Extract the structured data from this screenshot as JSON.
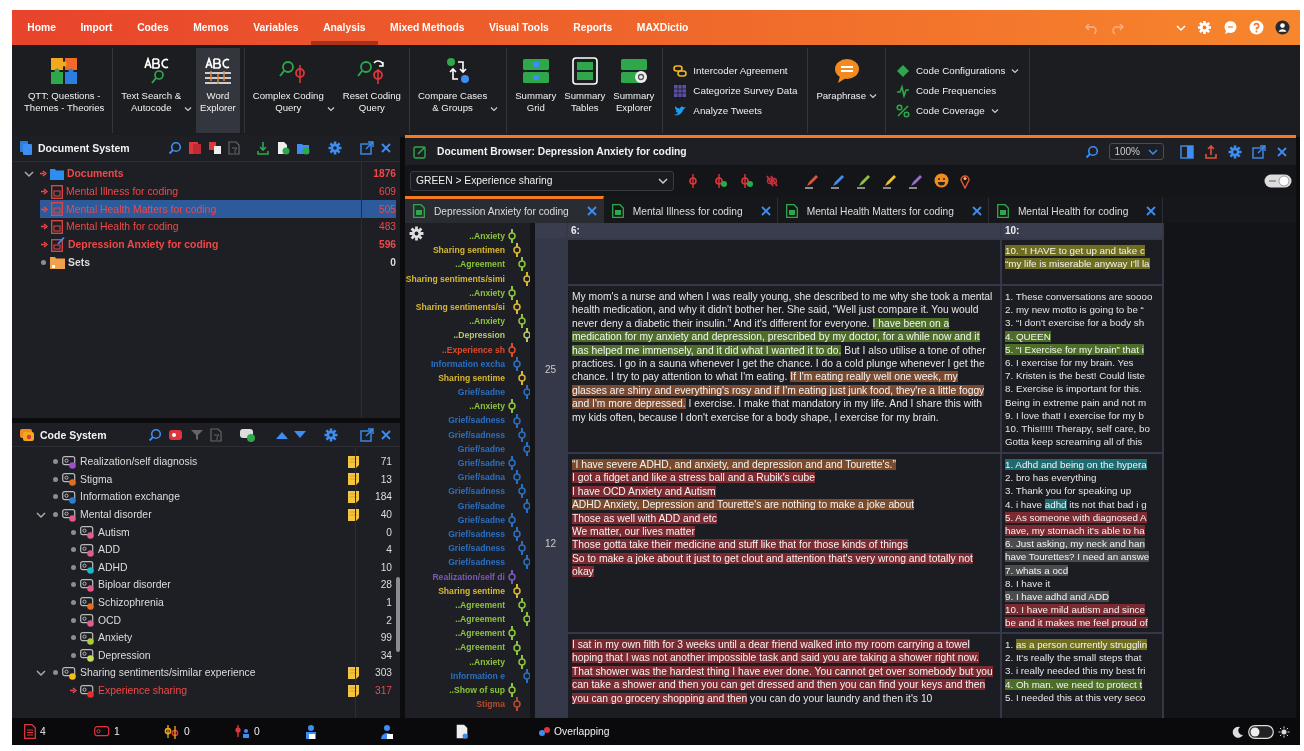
{
  "menu_tabs": [
    {
      "label": "Home",
      "selected": false
    },
    {
      "label": "Import",
      "selected": false
    },
    {
      "label": "Codes",
      "selected": false
    },
    {
      "label": "Memos",
      "selected": false
    },
    {
      "label": "Variables",
      "selected": false
    },
    {
      "label": "Analysis",
      "selected": true
    },
    {
      "label": "Mixed Methods",
      "selected": false
    },
    {
      "label": "Visual Tools",
      "selected": false
    },
    {
      "label": "Reports",
      "selected": false
    },
    {
      "label": "MAXDictio",
      "selected": false
    }
  ],
  "ribbon": {
    "groups": [
      {
        "items": [
          {
            "kind": "large",
            "label": "QTT: Questions -\nThemes - Theories",
            "selected": false,
            "has_menu": false
          }
        ]
      },
      {
        "items": [
          {
            "kind": "large",
            "label": "Text Search &\nAutocode",
            "selected": false,
            "has_menu": true
          },
          {
            "kind": "large",
            "label": "Word\nExplorer",
            "selected": true,
            "has_menu": false
          }
        ]
      },
      {
        "items": [
          {
            "kind": "large",
            "label": "Complex Coding\nQuery",
            "selected": false,
            "has_menu": true
          },
          {
            "kind": "large",
            "label": "Reset Coding\nQuery",
            "selected": false,
            "has_menu": false
          }
        ]
      },
      {
        "items": [
          {
            "kind": "large",
            "label": "Compare Cases\n& Groups",
            "selected": false,
            "has_menu": true
          }
        ]
      },
      {
        "items": [
          {
            "kind": "large",
            "label": "Summary\nGrid",
            "selected": false,
            "has_menu": false
          },
          {
            "kind": "large",
            "label": "Summary\nTables",
            "selected": false,
            "has_menu": false
          },
          {
            "kind": "large",
            "label": "Summary\nExplorer",
            "selected": false,
            "has_menu": false
          }
        ]
      },
      {
        "items": [
          {
            "kind": "small",
            "label": "Intercoder Agreement",
            "selected": false,
            "has_menu": false
          },
          {
            "kind": "small",
            "label": "Categorize Survey Data",
            "selected": false,
            "has_menu": false
          },
          {
            "kind": "small",
            "label": "Analyze Tweets",
            "selected": false,
            "has_menu": false
          }
        ]
      },
      {
        "items": [
          {
            "kind": "large",
            "label": "Paraphrase",
            "selected": false,
            "has_menu": true
          }
        ]
      },
      {
        "items": [
          {
            "kind": "small",
            "label": "Code Configurations",
            "selected": false,
            "has_menu": true
          },
          {
            "kind": "small",
            "label": "Code Frequencies",
            "selected": false,
            "has_menu": false
          },
          {
            "kind": "small",
            "label": "Code Coverage",
            "selected": false,
            "has_menu": true
          }
        ]
      }
    ]
  },
  "document_system": {
    "title": "Document System",
    "items": [
      {
        "label": "Documents",
        "count": "1876",
        "kind": "folder",
        "activated": true,
        "emphasized": true,
        "selected": false,
        "expanded": true,
        "children": [
          {
            "label": "Mental Illness for coding",
            "count": "609",
            "kind": "document",
            "activated": true,
            "emphasized": false,
            "selected": false
          },
          {
            "label": "Mental Health Matters for coding",
            "count": "505",
            "kind": "document",
            "activated": true,
            "emphasized": false,
            "selected": true
          },
          {
            "label": "Mental Health for coding",
            "count": "483",
            "kind": "document",
            "activated": true,
            "emphasized": false,
            "selected": false
          },
          {
            "label": "Depression Anxiety for coding",
            "count": "596",
            "kind": "edited-document",
            "activated": true,
            "emphasized": true,
            "selected": false
          }
        ]
      },
      {
        "label": "Sets",
        "count": "0",
        "kind": "set",
        "activated": false,
        "emphasized": true,
        "selected": false,
        "expanded": false
      }
    ]
  },
  "code_system": {
    "title": "Code System",
    "items": [
      {
        "label": "Realization/self diagnosis",
        "count": "71",
        "color": "#9b4fd0",
        "memo": true,
        "activated": false,
        "expanded": false
      },
      {
        "label": "Stigma",
        "count": "13",
        "color": "#e07020",
        "memo": true,
        "activated": false,
        "expanded": false
      },
      {
        "label": "Information exchange",
        "count": "184",
        "color": "#2a7fd0",
        "memo": true,
        "activated": false,
        "expanded": false
      },
      {
        "label": "Mental disorder",
        "count": "40",
        "color": "#e05a8a",
        "memo": true,
        "activated": false,
        "expanded": true,
        "children": [
          {
            "label": "Autism",
            "count": "0",
            "color": "#e05a8a",
            "memo": false,
            "activated": false,
            "expanded": false
          },
          {
            "label": "ADD",
            "count": "4",
            "color": "#e05a8a",
            "memo": false,
            "activated": false,
            "expanded": false
          },
          {
            "label": "ADHD",
            "count": "10",
            "color": "#20b8c8",
            "memo": false,
            "activated": false,
            "expanded": false
          },
          {
            "label": "Biploar disorder",
            "count": "28",
            "color": "#e05a8a",
            "memo": false,
            "activated": false,
            "expanded": false
          },
          {
            "label": "Schizophrenia",
            "count": "1",
            "color": "#e07020",
            "memo": false,
            "activated": false,
            "expanded": false
          },
          {
            "label": "OCD",
            "count": "2",
            "color": "#e05a8a",
            "memo": false,
            "activated": false,
            "expanded": false
          },
          {
            "label": "Anxiety",
            "count": "99",
            "color": "#a8d030",
            "memo": false,
            "activated": false,
            "expanded": false
          },
          {
            "label": "Depression",
            "count": "34",
            "color": "#c8dc60",
            "memo": false,
            "activated": false,
            "expanded": false
          }
        ]
      },
      {
        "label": "Sharing sentiments/similar experience",
        "count": "303",
        "color": "#f0c020",
        "memo": true,
        "activated": false,
        "expanded": true,
        "children": [
          {
            "label": "Experience sharing",
            "count": "317",
            "color": "#e03030",
            "memo": true,
            "activated": true,
            "expanded": false
          }
        ]
      }
    ]
  },
  "document_browser": {
    "title": "Document Browser: Depression Anxiety for coding",
    "zoom": "100%",
    "code_selector": "GREEN > Experience sharing",
    "tabs": [
      {
        "label": "Depression Anxiety for coding",
        "selected": true
      },
      {
        "label": "Mental Illness for coding",
        "selected": false
      },
      {
        "label": "Mental Health Matters for coding",
        "selected": false
      },
      {
        "label": "Mental Health for coding",
        "selected": false
      }
    ],
    "margin_labels": [
      {
        "text": "..Anxiety",
        "color": "#8cc43c"
      },
      {
        "text": "Sharing sentimen",
        "color": "#d8b830"
      },
      {
        "text": "..Agreement",
        "color": "#8cc43c"
      },
      {
        "text": "Sharing sentiments/simi",
        "color": "#d8b830"
      },
      {
        "text": "..Anxiety",
        "color": "#8cc43c"
      },
      {
        "text": "Sharing sentiments/si",
        "color": "#d8b830"
      },
      {
        "text": "..Anxiety",
        "color": "#8cc43c"
      },
      {
        "text": "..Depression",
        "color": "#b8c870"
      },
      {
        "text": "..Experience sh",
        "color": "#e04a2a"
      },
      {
        "text": "Information excha",
        "color": "#2a6fc0"
      },
      {
        "text": "Sharing sentime",
        "color": "#d8b830"
      },
      {
        "text": "Grief/sadne",
        "color": "#2a6fc0"
      },
      {
        "text": "..Anxiety",
        "color": "#8cc43c"
      },
      {
        "text": "Grief/sadness",
        "color": "#2a6fc0"
      },
      {
        "text": "Grief/sadness",
        "color": "#2a6fc0"
      },
      {
        "text": "Grief/sadne",
        "color": "#2a6fc0"
      },
      {
        "text": "Grief/sadne",
        "color": "#2a6fc0"
      },
      {
        "text": "Grief/sadna",
        "color": "#2a6fc0"
      },
      {
        "text": "Grief/sadness",
        "color": "#2a6fc0"
      },
      {
        "text": "Grief/sadne",
        "color": "#2a6fc0"
      },
      {
        "text": "Grief/sadne",
        "color": "#2a6fc0"
      },
      {
        "text": "Grief/sadness",
        "color": "#2a6fc0"
      },
      {
        "text": "Grief/sadness",
        "color": "#2a6fc0"
      },
      {
        "text": "Grief/sadness",
        "color": "#2a6fc0"
      },
      {
        "text": "Realization/self di",
        "color": "#7a5ab8"
      },
      {
        "text": "Sharing sentime",
        "color": "#d8b830"
      },
      {
        "text": "..Agreement",
        "color": "#8cc43c"
      },
      {
        "text": "..Agreement",
        "color": "#8cc43c"
      },
      {
        "text": "..Agreement",
        "color": "#8cc43c"
      },
      {
        "text": "..Agreement",
        "color": "#8cc43c"
      },
      {
        "text": "..Anxiety",
        "color": "#8cc43c"
      },
      {
        "text": "Information e",
        "color": "#2a6fc0"
      },
      {
        "text": "..Show of sup",
        "color": "#8cc43c"
      },
      {
        "text": "Stigma",
        "color": "#b84a2a"
      }
    ],
    "header": {
      "column_1": "6:",
      "column_2": "10:"
    },
    "rows": [
      {
        "paragraph": "",
        "left": [],
        "right": [
          [
            {
              "text": "10.  “I HAVE to get up and take c",
              "color": "#6e6e1e"
            }
          ],
          [
            {
              "text": "“my life is miserable anyway I'll la",
              "color": "#6e6e1e"
            }
          ]
        ]
      },
      {
        "paragraph": "25",
        "left": [
          [
            {
              "text": "My mom's a nurse and when I was really young, she described to me why she took a mental health medication, and why it didn't bother her. She said, “Well just compare it. You would never deny a diabetic their insulin.” And it's different for everyone. "
            },
            {
              "text": "I have been on a medication for my anxiety and depression, prescribed by my doctor, for a while now and it has helped me immensely, and it did what I wanted it to do.",
              "color": "#4c6e28"
            },
            {
              "text": " But I also utilise a tone of other practices. I go in a sauna whenever I get the chance. I do a cold plunge whenever I get the chance. I try to pay attention to what I'm eating. "
            },
            {
              "text": "If I'm eating really well one week, my glasses are shiny and everything's rosy and if I'm eating just junk food, they're a little foggy and I'm more depressed.",
              "color": "#7a4a30"
            },
            {
              "text": " I exercise. I make that mandatory in my life. And I share this with my kids often, because I don't exercise for a body shape, I exercise for my brain."
            }
          ]
        ],
        "right": [
          [
            {
              "text": "1. These conversations are soooo"
            }
          ],
          [
            {
              "text": "2. my new motto is going to be “"
            }
          ],
          [
            {
              "text": "3. “I don't exercise for a body sh"
            }
          ],
          [
            {
              "text": "4. QUEEN",
              "color": "#4c6e28"
            }
          ],
          [
            {
              "text": "5. “I Exercise for my brain” that i",
              "color": "#4c6e28"
            }
          ],
          [
            {
              "text": "6. I exercise for my brain. Yes"
            }
          ],
          [
            {
              "text": "7. Kristen is the best! Could liste"
            }
          ],
          [
            {
              "text": "8.  Exercise is important for this."
            }
          ],
          [
            {
              "text": "Being in extreme pain and not m"
            }
          ],
          [
            {
              "text": "9. I love that! I exercise for my b"
            }
          ],
          [
            {
              "text": "10. This!!!!! Therapy, self care, bo"
            }
          ],
          [
            {
              "text": "Gotta keep screaming all of this"
            }
          ]
        ]
      },
      {
        "paragraph": "12",
        "left": [
          [
            {
              "text": "“I have severe ADHD, and anxiety, and depression and and Tourette's.”",
              "color": "#7a4a2a"
            }
          ],
          [
            {
              "text": "I got a fidget and like a stress ball and a Rubik's cube",
              "color": "#7a2a30"
            }
          ],
          [
            {
              "text": "I have OCD Anxiety and Autism",
              "color": "#7a2a30"
            }
          ],
          [
            {
              "text": "ADHD Anxiety, Depression and Tourette's are nothing to make a joke about",
              "color": "#7a4a2a"
            }
          ],
          [
            {
              "text": "Those as well with ADD and etc",
              "color": "#7a2a30"
            }
          ],
          [
            {
              "text": "We matter, our lives matter",
              "color": "#7a2a30"
            }
          ],
          [
            {
              "text": "Those gotta take their medicine and stuff like that for those kinds of things",
              "color": "#7a2a30"
            }
          ],
          [
            {
              "text": "So to make a joke about it just to get clout and attention that's very wrong and totally not okay",
              "color": "#7a2a30"
            }
          ]
        ],
        "right": [
          [
            {
              "text": "1.  Adhd and being on the hypera",
              "color": "#1e6a6e"
            }
          ],
          [
            {
              "text": "2.  bro has everything"
            }
          ],
          [
            {
              "text": "3.  Thank you for speaking up"
            }
          ],
          [
            {
              "text": "4.  i have "
            },
            {
              "text": "adhd",
              "color": "#1e6a6e"
            },
            {
              "text": " its not that bad i g"
            }
          ],
          [
            {
              "text": "5.  As someone with diagnosed A",
              "color": "#7a2a30"
            }
          ],
          [
            {
              "text": "have, my stomach it's able to ha",
              "color": "#7a2a30"
            }
          ],
          [
            {
              "text": "6.  Just asking, my neck and han",
              "color": "#4a4c4e"
            }
          ],
          [
            {
              "text": "have Tourettes? I need an answe",
              "color": "#4a4c4e"
            }
          ],
          [
            {
              "text": "7.  whats a ocd",
              "color": "#4a4c4e"
            }
          ],
          [
            {
              "text": "8.  I have it"
            }
          ],
          [
            {
              "text": "9.  I have adhd and ADD",
              "color": "#4a4c4e"
            }
          ],
          [
            {
              "text": "10.  I have mild autism and since",
              "color": "#7a2a30"
            }
          ],
          [
            {
              "text": "be and it makes me feel proud of",
              "color": "#7a2a30"
            }
          ]
        ]
      },
      {
        "paragraph": "",
        "left": [
          [
            {
              "text": "I sat in my own filth for 3 weeks until a dear friend walked into my room carrying a towel hoping that I was not another impossible task and said you are taking a shower right now. That shower was the hardest thing I have ever done. You cannot get over somebody but you can take a shower and then you can get dressed and then you can find your keys and then you can go grocery shopping and then",
              "color": "#7a2a30"
            },
            {
              "text": " you can do your laundry and then it's 10"
            }
          ]
        ],
        "right": [
          [
            {
              "text": "1.  "
            },
            {
              "text": "as a person currently strugglin",
              "color": "#6e6e1e"
            }
          ],
          [
            {
              "text": "2.  It's really the small steps that"
            }
          ],
          [
            {
              "text": "3.  i really needed this my best fri"
            }
          ],
          [
            {
              "text": "4.  Oh man. we need to protect t",
              "color": "#4c6e28"
            }
          ],
          [
            {
              "text": "5.  I needed this at this very seco"
            }
          ]
        ]
      }
    ]
  },
  "status_bar": {
    "counters": [
      {
        "kind": "documents",
        "value": "4"
      },
      {
        "kind": "codes",
        "value": "1"
      },
      {
        "kind": "segments",
        "value": "0"
      },
      {
        "kind": "memos",
        "value": "0"
      }
    ],
    "mode": "Overlapping"
  }
}
